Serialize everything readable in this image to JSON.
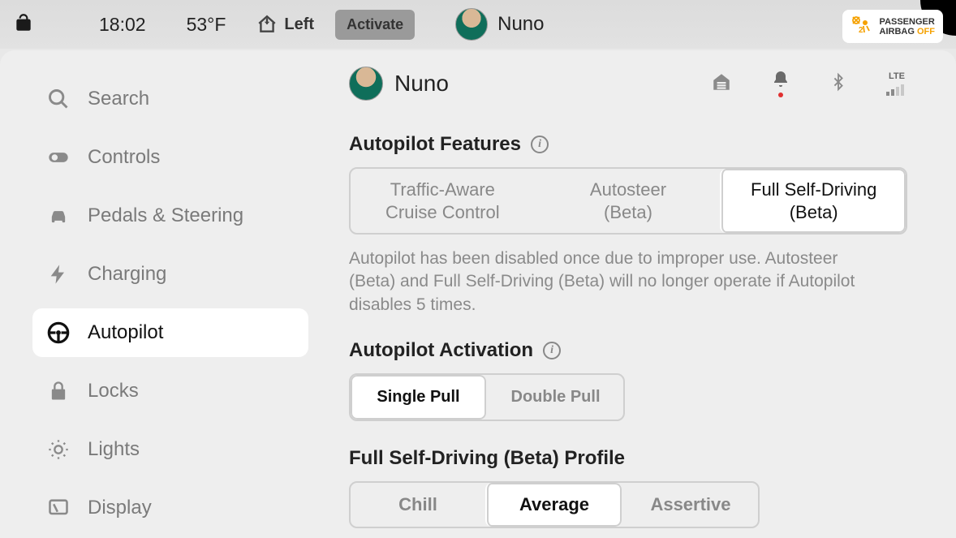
{
  "topbar": {
    "time": "18:02",
    "temperature": "53°F",
    "home_label": "Left",
    "activate_label": "Activate",
    "profile_name": "Nuno",
    "airbag_line1": "PASSENGER",
    "airbag_line2": "AIRBAG",
    "airbag_status": "OFF"
  },
  "sidebar": {
    "items": [
      {
        "label": "Search"
      },
      {
        "label": "Controls"
      },
      {
        "label": "Pedals & Steering"
      },
      {
        "label": "Charging"
      },
      {
        "label": "Autopilot"
      },
      {
        "label": "Locks"
      },
      {
        "label": "Lights"
      },
      {
        "label": "Display"
      }
    ]
  },
  "main": {
    "profile_name": "Nuno",
    "signal_label": "LTE",
    "features": {
      "title": "Autopilot Features",
      "opts": [
        {
          "l1": "Traffic-Aware",
          "l2": "Cruise Control"
        },
        {
          "l1": "Autosteer",
          "l2": "(Beta)"
        },
        {
          "l1": "Full Self-Driving",
          "l2": "(Beta)"
        }
      ],
      "note": "Autopilot has been disabled once due to improper use. Autosteer (Beta) and Full Self-Driving (Beta) will no longer operate if Autopilot disables 5 times."
    },
    "activation": {
      "title": "Autopilot Activation",
      "opts": [
        "Single Pull",
        "Double Pull"
      ]
    },
    "profile": {
      "title": "Full Self-Driving (Beta) Profile",
      "opts": [
        "Chill",
        "Average",
        "Assertive"
      ]
    }
  }
}
